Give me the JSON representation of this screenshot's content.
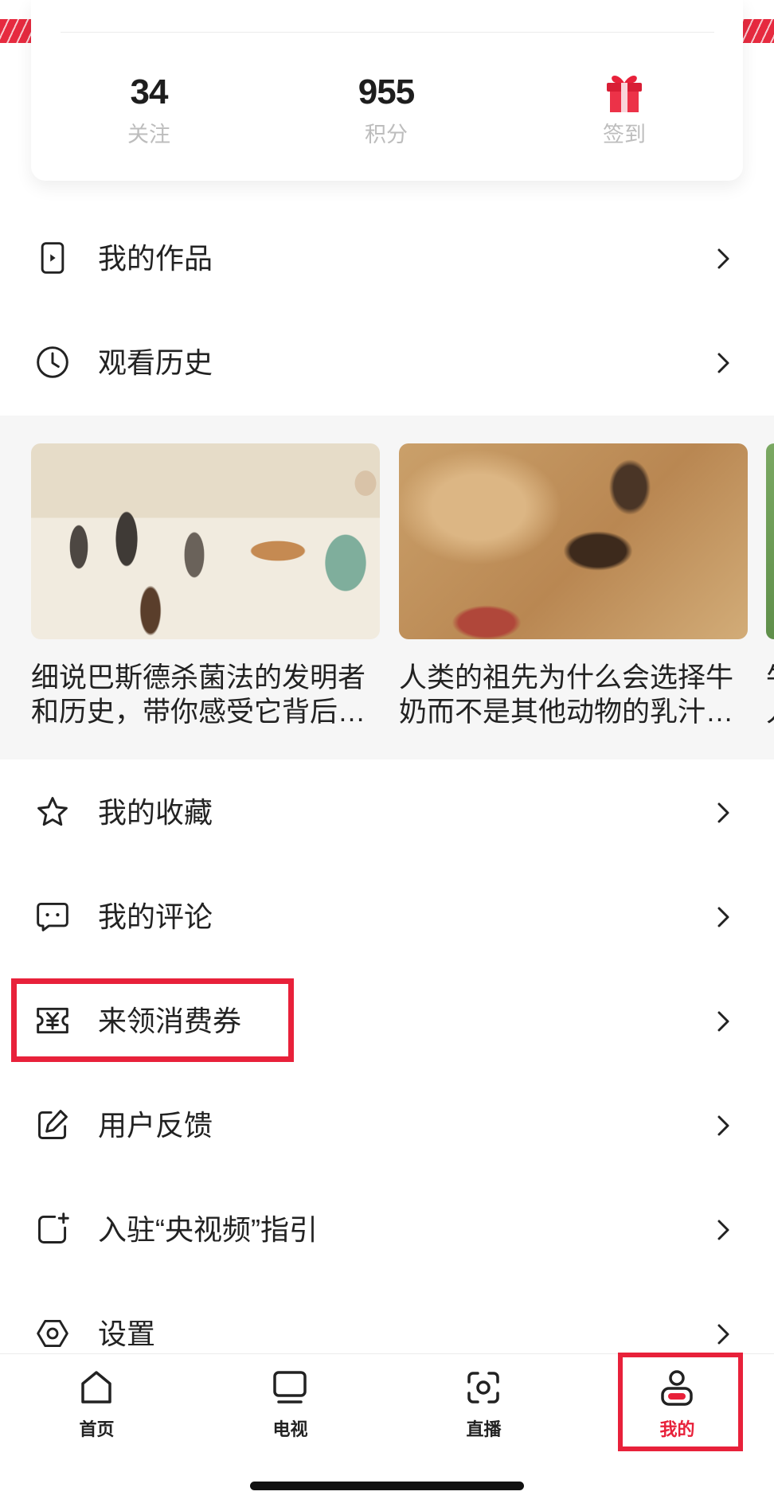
{
  "stats": [
    {
      "value": "34",
      "label": "关注"
    },
    {
      "value": "955",
      "label": "积分"
    },
    {
      "icon": "gift-icon",
      "label": "签到"
    }
  ],
  "menu_top": [
    {
      "icon": "works-icon",
      "label": "我的作品"
    },
    {
      "icon": "clock-icon",
      "label": "观看历史"
    }
  ],
  "history_cards": [
    {
      "line1": "细说巴斯德杀菌法的发明者",
      "line2": "和历史，带你感受它背后…"
    },
    {
      "line1": "人类的祖先为什么会选择牛",
      "line2": "奶而不是其他动物的乳汁…"
    },
    {
      "line1": "牛",
      "line2": "人"
    }
  ],
  "menu_bottom": [
    {
      "icon": "star-icon",
      "label": "我的收藏",
      "highlighted": false
    },
    {
      "icon": "comment-icon",
      "label": "我的评论",
      "highlighted": false
    },
    {
      "icon": "coupon-icon",
      "label": "来领消费券",
      "highlighted": true
    },
    {
      "icon": "edit-icon",
      "label": "用户反馈",
      "highlighted": false
    },
    {
      "icon": "add-square-icon",
      "label": "入驻“央视频”指引",
      "highlighted": false
    },
    {
      "icon": "settings-icon",
      "label": "设置",
      "highlighted": false
    }
  ],
  "tabs": [
    {
      "icon": "home-icon",
      "label": "首页",
      "active": false,
      "highlighted": false
    },
    {
      "icon": "tv-icon",
      "label": "电视",
      "active": false,
      "highlighted": false
    },
    {
      "icon": "live-icon",
      "label": "直播",
      "active": false,
      "highlighted": false
    },
    {
      "icon": "profile-icon",
      "label": "我的",
      "active": true,
      "highlighted": true
    }
  ],
  "colors": {
    "accent": "#e8213a",
    "text": "#222222",
    "muted": "#bdbdbd",
    "section_bg": "#f6f6f6"
  }
}
